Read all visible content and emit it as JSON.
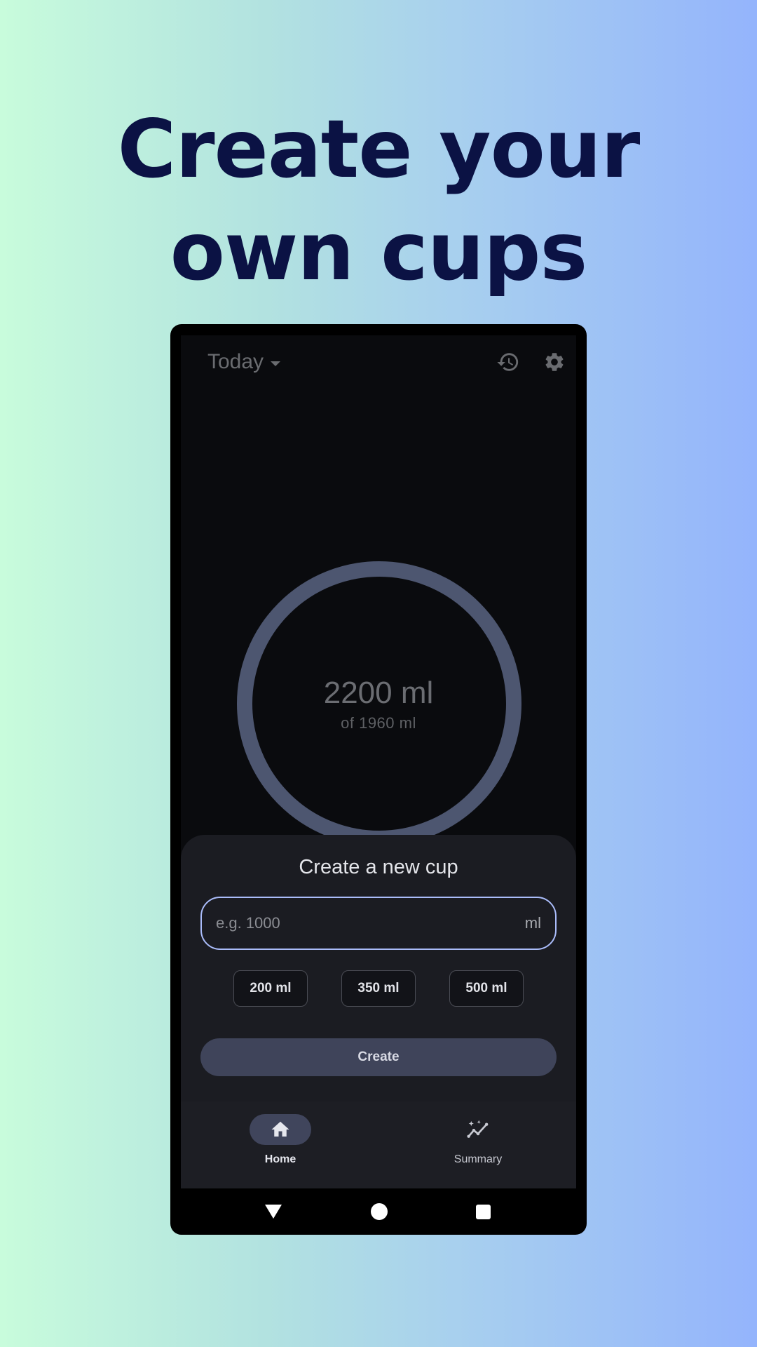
{
  "headline": {
    "line1": "Create your",
    "line2": "own cups"
  },
  "colors": {
    "background_left": "#c8fcdc",
    "background_right": "#94b4fc",
    "headline": "#0b1244",
    "ring": "#4d5670",
    "input_border": "#aabcfa",
    "create_button": "#3f445a",
    "nav_active_pill": "#40455c"
  },
  "app": {
    "topbar": {
      "date_filter": "Today",
      "date_icon": "dropdown-caret-icon",
      "history_icon": "history-icon",
      "settings_icon": "gear-icon"
    },
    "progress": {
      "value": "2200 ml",
      "goal": "of 1960 ml",
      "fraction": 1.0
    },
    "sheet": {
      "title": "Create a new cup",
      "input": {
        "placeholder": "e.g. 1000",
        "value": "",
        "unit": "ml"
      },
      "presets": [
        "200 ml",
        "350 ml",
        "500 ml"
      ],
      "create_label": "Create"
    },
    "bottom_nav": {
      "items": [
        {
          "label": "Home",
          "icon": "home-icon",
          "active": true
        },
        {
          "label": "Summary",
          "icon": "summary-chart-icon",
          "active": false
        }
      ]
    },
    "system_nav": {
      "back_icon": "back-triangle-icon",
      "home_icon": "home-circle-icon",
      "recents_icon": "recents-square-icon"
    }
  }
}
